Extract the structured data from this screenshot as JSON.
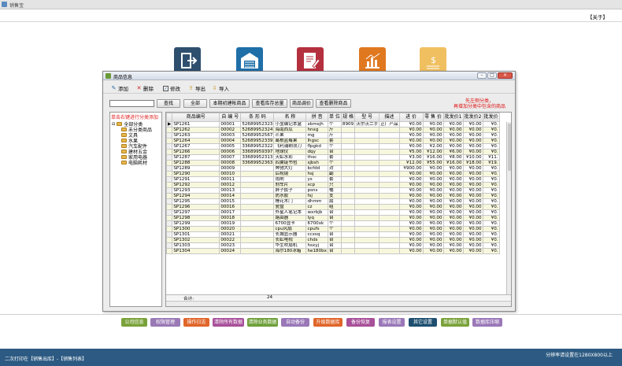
{
  "app": {
    "title": "销售宝",
    "about": "【关于】"
  },
  "top_icons": [
    {
      "name": "exit",
      "color": "#2f4f6f"
    },
    {
      "name": "warehouse",
      "color": "#1f6fa8"
    },
    {
      "name": "report",
      "color": "#b5303f"
    },
    {
      "name": "chart",
      "color": "#e07820"
    },
    {
      "name": "money",
      "color": "#f0c060"
    }
  ],
  "window": {
    "title": "商品信息",
    "toolbar": {
      "add": "添加",
      "delete": "删除",
      "edit": "修改",
      "export": "导出",
      "import": "导入"
    },
    "search": {
      "value": "",
      "find_btn": "查找",
      "all_btn": "全部",
      "tab1": "本期初建帐商品",
      "tab2": "查看库存总量",
      "tab3": "商品调价",
      "tab4": "查看删除商品"
    },
    "red_tip": [
      "先左侧分类，",
      "再增加分类中包含的商品"
    ],
    "tree": {
      "hint": "单击右键进行分类添加",
      "root": "全部分类",
      "items": [
        "未分类商品",
        "文具",
        "水果",
        "汽车配件",
        "建材五金",
        "家用电器",
        "电脑耗材"
      ]
    },
    "grid": {
      "columns": [
        "商品编号",
        "自 编 号",
        "条 形 码",
        "名  称",
        "拼  音",
        "单  位",
        "规  格",
        "型  号",
        "描述",
        "进  价",
        "零 售 价",
        "批发价1",
        "批发价2",
        "批发价"
      ],
      "rows": [
        [
          "SP1261",
          "00001",
          "52689952323",
          "小显编记本盒",
          "xbmsjh",
          "个",
          "8909",
          "沃尔沃二手",
          "正厂产品",
          "¥0.00",
          "¥0.00",
          "¥0.00",
          "¥0.00",
          "¥0."
        ],
        [
          "SP1262",
          "00002",
          "52689952324",
          "海南西瓜",
          "hnxg",
          "斤",
          "",
          "",
          "",
          "¥0.00",
          "¥0.00",
          "¥0.00",
          "¥0.00",
          "¥0."
        ],
        [
          "SP1263",
          "00003",
          "52689952567",
          "芒果",
          "mg",
          "斤",
          "",
          "",
          "",
          "¥0.00",
          "¥0.00",
          "¥0.00",
          "¥0.00",
          "¥0."
        ],
        [
          "SP1264",
          "00004",
          "52689952339",
          "葛根蓝莓果",
          "lhgsc",
          "套",
          "",
          "",
          "",
          "¥0.00",
          "¥0.00",
          "¥0.00",
          "¥0.00",
          "¥0."
        ],
        [
          "SP1267",
          "00005",
          "33689952322",
          "飞利浦剃须刀",
          "flpgkd",
          "个",
          "",
          "",
          "",
          "¥0.00",
          "¥2.00",
          "¥0.00",
          "¥0.00",
          "¥0."
        ],
        [
          "SP1266",
          "00006",
          "33689959397",
          "地球仪",
          "dqy",
          "台",
          "",
          "",
          "",
          "¥5.00",
          "¥12.00",
          "¥6.00",
          "¥0.00",
          "¥0."
        ],
        [
          "SP1287",
          "00007",
          "33689952313",
          "天虹水彩",
          "thsc",
          "套",
          "",
          "",
          "",
          "¥3.00",
          "¥16.00",
          "¥8.00",
          "¥10.00",
          "¥11."
        ],
        [
          "SP1288",
          "00008",
          "33689952363",
          "四翼链书包",
          "sjbsh",
          "个",
          "",
          "",
          "",
          "¥12.00",
          "¥55.00",
          "¥16.00",
          "¥18.00",
          "¥19."
        ],
        [
          "SP1289",
          "00009",
          "",
          "奔驰大灯",
          "bcfdd",
          "对",
          "",
          "",
          "",
          "¥900.00",
          "¥0.00",
          "¥0.00",
          "¥0.00",
          "¥0."
        ],
        [
          "SP1290",
          "00010",
          "",
          "后视镜",
          "hsj",
          "副",
          "",
          "",
          "",
          "¥0.00",
          "¥0.00",
          "¥0.00",
          "¥0.00",
          "¥0."
        ],
        [
          "SP1291",
          "00011",
          "",
          "雨刷",
          "ys",
          "套",
          "",
          "",
          "",
          "¥0.00",
          "¥0.00",
          "¥0.00",
          "¥0.00",
          "¥0."
        ],
        [
          "SP1292",
          "00012",
          "",
          "刹车片",
          "scp",
          "只",
          "",
          "",
          "",
          "¥0.00",
          "¥0.00",
          "¥0.00",
          "¥0.00",
          "¥0."
        ],
        [
          "SP1293",
          "00013",
          "",
          "胖子扳子",
          "psns",
          "桶",
          "",
          "",
          "",
          "¥0.00",
          "¥0.00",
          "¥0.00",
          "¥0.00",
          "¥0."
        ],
        [
          "SP1294",
          "00014",
          "",
          "防水胶",
          "fsj",
          "支",
          "",
          "",
          "",
          "¥0.00",
          "¥0.00",
          "¥0.00",
          "¥0.00",
          "¥0."
        ],
        [
          "SP1295",
          "00015",
          "",
          "睡花木门",
          "dhmm",
          "扇",
          "",
          "",
          "",
          "¥0.00",
          "¥0.00",
          "¥0.00",
          "¥0.00",
          "¥0."
        ],
        [
          "SP1296",
          "00016",
          "",
          "瓷盘",
          "cz",
          "组",
          "",
          "",
          "",
          "¥0.00",
          "¥0.00",
          "¥0.00",
          "¥0.00",
          "¥0."
        ],
        [
          "SP1297",
          "00017",
          "",
          "外星人笔记本",
          "wxrbjb",
          "台",
          "",
          "",
          "",
          "¥0.00",
          "¥0.00",
          "¥0.00",
          "¥0.00",
          "¥0."
        ],
        [
          "SP1298",
          "00018",
          "",
          "路由器",
          "lyq",
          "台",
          "",
          "",
          "",
          "¥0.00",
          "¥0.00",
          "¥0.00",
          "¥0.00",
          "¥0."
        ],
        [
          "SP1299",
          "00019",
          "",
          "6700显卡",
          "6700xk",
          "个",
          "",
          "",
          "",
          "¥0.00",
          "¥0.00",
          "¥0.00",
          "¥0.00",
          "¥0."
        ],
        [
          "SP1300",
          "00020",
          "",
          "cpu风扇",
          "cpufs",
          "个",
          "",
          "",
          "",
          "¥0.00",
          "¥0.00",
          "¥0.00",
          "¥0.00",
          "¥0."
        ],
        [
          "SP1301",
          "00021",
          "",
          "长城显示器",
          "ccxsq",
          "台",
          "",
          "",
          "",
          "¥0.00",
          "¥0.00",
          "¥0.00",
          "¥0.00",
          "¥0."
        ],
        [
          "SP1302",
          "00022",
          "",
          "长虹电视",
          "chds",
          "台",
          "",
          "",
          "",
          "¥0.00",
          "¥0.00",
          "¥0.00",
          "¥0.00",
          "¥0."
        ],
        [
          "SP1303",
          "00023",
          "",
          "华生吹扇机",
          "hsxyj",
          "台",
          "",
          "",
          "",
          "¥0.00",
          "¥0.00",
          "¥0.00",
          "¥0.00",
          "¥0."
        ],
        [
          "SP1304",
          "00024",
          "",
          "海尔180冰箱",
          "he180bx",
          "台",
          "",
          "",
          "",
          "¥0.00",
          "¥0.00",
          "¥0.00",
          "¥0.00",
          "¥0."
        ]
      ],
      "total_label": "合计:",
      "total_value": "24"
    }
  },
  "bottom_buttons": [
    {
      "label": "公司信息",
      "color": "#7aa23a"
    },
    {
      "label": "权限管理",
      "color": "#9a7ab6"
    },
    {
      "label": "操作日志",
      "color": "#e0662a"
    },
    {
      "label": "清除所有数据",
      "color": "#a8509a"
    },
    {
      "label": "清除业务数据",
      "color": "#6ea03a"
    },
    {
      "label": "自动备份",
      "color": "#9a78b8"
    },
    {
      "label": "升级数据库",
      "color": "#e0662a"
    },
    {
      "label": "备份恢复",
      "color": "#a8509a"
    },
    {
      "label": "报表设置",
      "color": "#9a78b8"
    },
    {
      "label": "其它设置",
      "color": "#1e4f70"
    },
    {
      "label": "单据默认值",
      "color": "#7aa23a"
    },
    {
      "label": "数据库压缩",
      "color": "#9a78b8"
    }
  ],
  "status": {
    "left": "二次打印在【销售出库】-【销售列表】",
    "right": "分辨率请设置在1280X800以上"
  }
}
